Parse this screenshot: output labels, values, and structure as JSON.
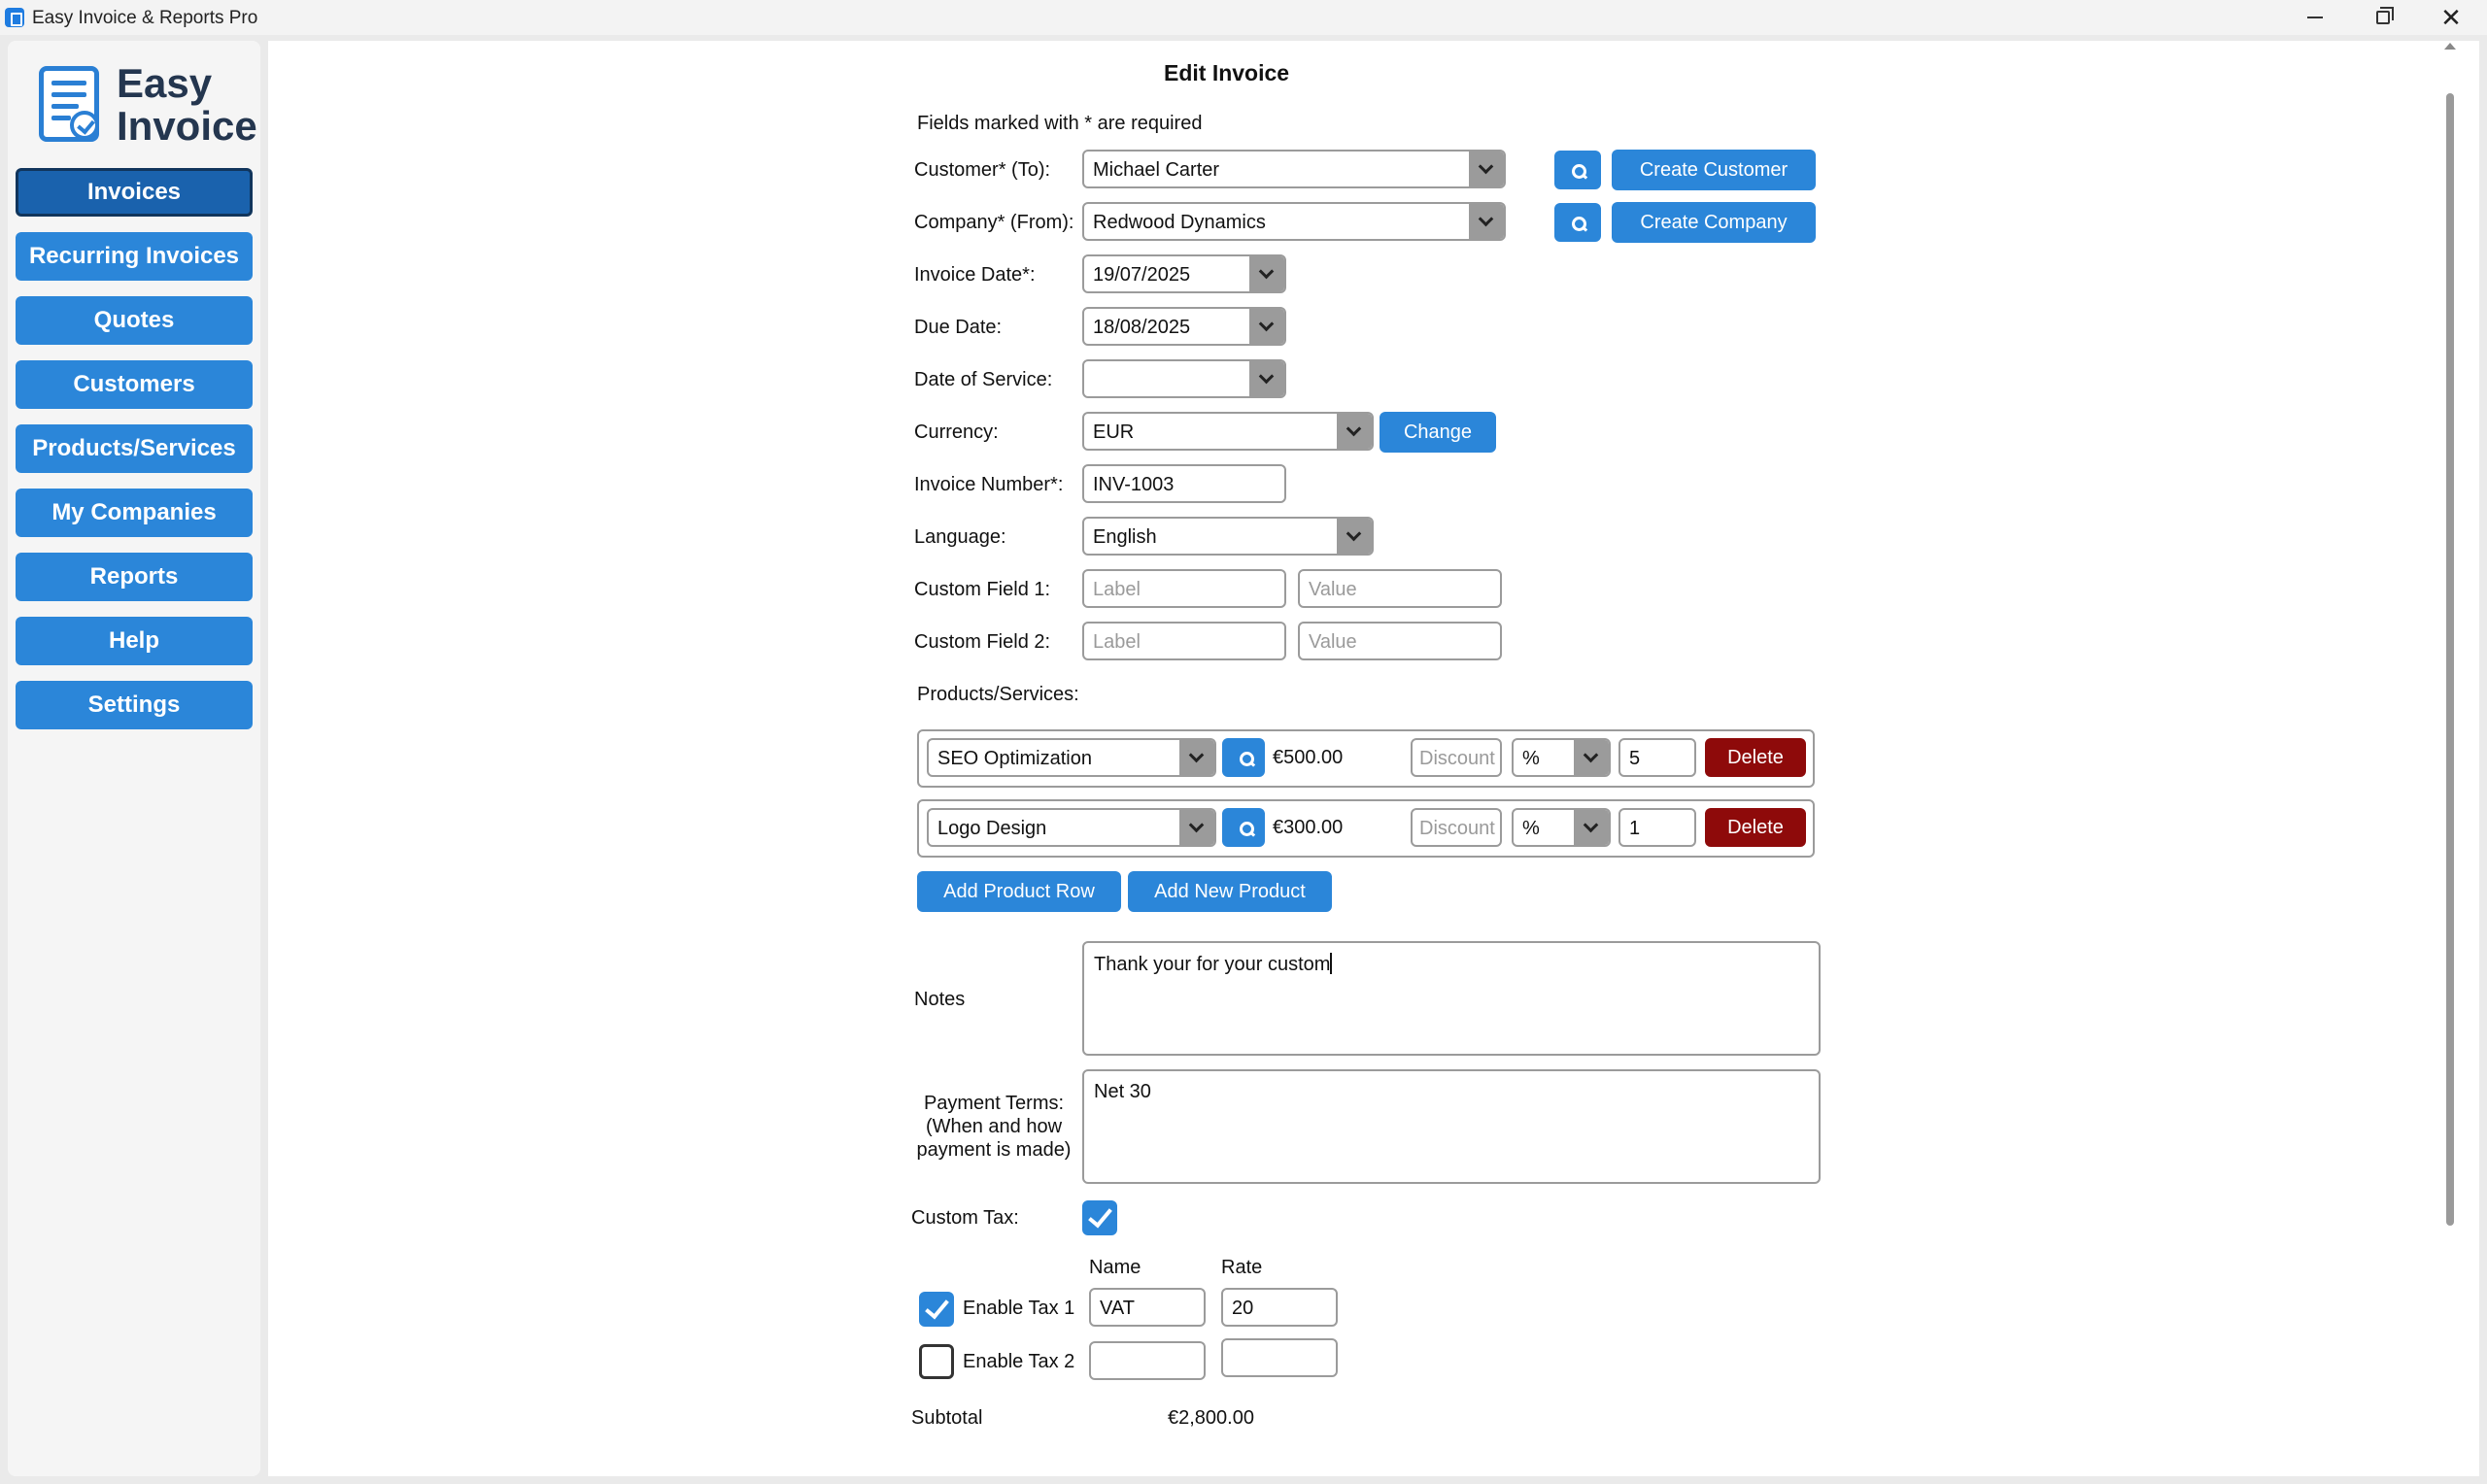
{
  "window": {
    "title": "Easy Invoice & Reports Pro"
  },
  "sidebar": {
    "logo_line1": "Easy",
    "logo_line2": "Invoice",
    "items": [
      {
        "label": "Invoices",
        "active": true
      },
      {
        "label": "Recurring Invoices"
      },
      {
        "label": "Quotes"
      },
      {
        "label": "Customers"
      },
      {
        "label": "Products/Services"
      },
      {
        "label": "My Companies"
      },
      {
        "label": "Reports"
      },
      {
        "label": "Help"
      },
      {
        "label": "Settings"
      }
    ]
  },
  "form": {
    "title": "Edit Invoice",
    "required_note": "Fields marked with * are required",
    "customer": {
      "label": "Customer* (To):",
      "value": "Michael Carter",
      "create_label": "Create Customer"
    },
    "company": {
      "label": "Company* (From):",
      "value": "Redwood Dynamics",
      "create_label": "Create Company"
    },
    "invoice_date": {
      "label": "Invoice Date*:",
      "value": "19/07/2025"
    },
    "due_date": {
      "label": "Due Date:",
      "value": "18/08/2025"
    },
    "date_of_service": {
      "label": "Date of Service:",
      "value": ""
    },
    "currency": {
      "label": "Currency:",
      "value": "EUR",
      "change_label": "Change"
    },
    "invoice_number": {
      "label": "Invoice Number*:",
      "value": "INV-1003"
    },
    "language": {
      "label": "Language:",
      "value": "English"
    },
    "custom_field_1": {
      "label": "Custom Field 1:",
      "label_placeholder": "Label",
      "value_placeholder": "Value"
    },
    "custom_field_2": {
      "label": "Custom Field 2:",
      "label_placeholder": "Label",
      "value_placeholder": "Value"
    },
    "products_label": "Products/Services:",
    "products": [
      {
        "name": "SEO Optimization",
        "price": "€500.00",
        "discount_placeholder": "Discount",
        "discount_type": "%",
        "quantity": "5",
        "delete_label": "Delete"
      },
      {
        "name": "Logo Design",
        "price": "€300.00",
        "discount_placeholder": "Discount",
        "discount_type": "%",
        "quantity": "1",
        "delete_label": "Delete"
      }
    ],
    "add_row_label": "Add Product Row",
    "add_product_label": "Add New Product",
    "notes": {
      "label": "Notes",
      "value": "Thank your for your custom"
    },
    "payment_terms": {
      "label_line1": "Payment Terms:",
      "label_line2": "(When and how",
      "label_line3": "payment is made)",
      "value": "Net 30"
    },
    "custom_tax": {
      "label": "Custom Tax:",
      "checked": true
    },
    "tax_headers": {
      "name": "Name",
      "rate": "Rate"
    },
    "taxes": [
      {
        "label": "Enable Tax 1",
        "checked": true,
        "name": "VAT",
        "rate": "20"
      },
      {
        "label": "Enable Tax 2",
        "checked": false,
        "name": "",
        "rate": ""
      }
    ],
    "subtotal": {
      "label": "Subtotal",
      "value": "€2,800.00"
    }
  },
  "icons": [
    "app-icon",
    "minimize-icon",
    "maximize-icon",
    "close-icon",
    "invoice-logo-icon",
    "search-icon",
    "chevron-down-icon",
    "checkmark-icon"
  ]
}
